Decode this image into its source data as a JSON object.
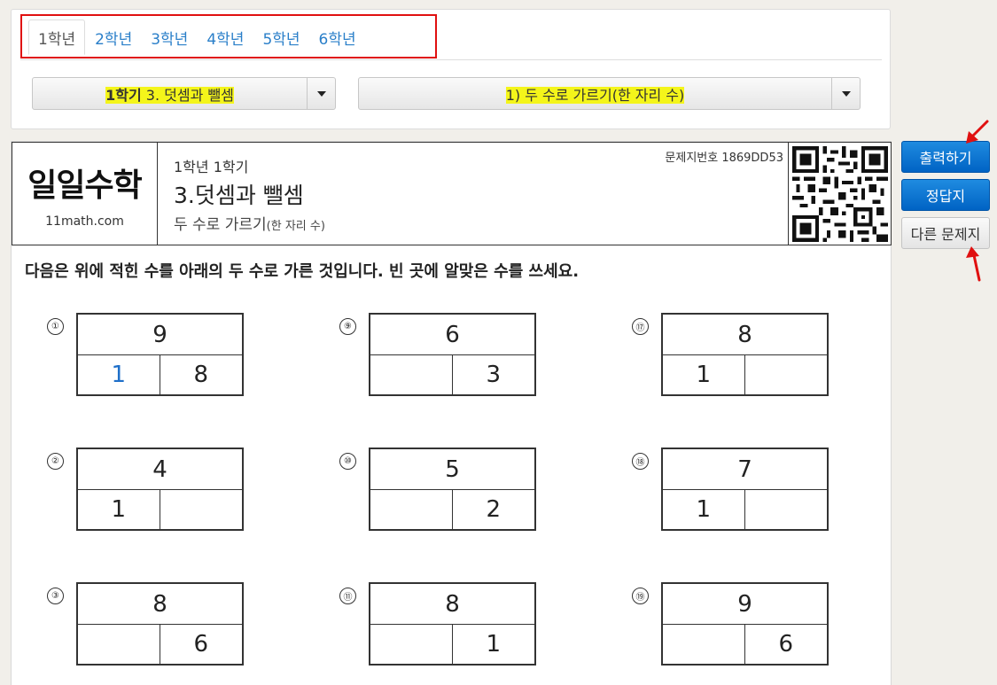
{
  "grade_tabs": [
    "1학년",
    "2학년",
    "3학년",
    "4학년",
    "5학년",
    "6학년"
  ],
  "unit_select": {
    "bold": "1학기",
    "rest": " 3. 덧셈과 뺄셈"
  },
  "topic_select": {
    "label": "1) 두 수로 가르기(한 자리 수)"
  },
  "header": {
    "logo": "일일수학",
    "url": "11math.com",
    "grade_semester": "1학년 1학기",
    "unit_title": "3.덧셈과 뺄셈",
    "subtitle_main": "두 수로 가르기",
    "subtitle_small": "(한 자리 수)",
    "sheet_code": "문제지번호 1869DD53"
  },
  "instruction": "다음은 위에 적힌 수를 아래의 두 수로 가른 것입니다. 빈 곳에 알맞은 수를 쓰세요.",
  "problems": [
    {
      "num": "①",
      "top": "9",
      "left": "1",
      "right": "8",
      "left_blue": true
    },
    {
      "num": "②",
      "top": "4",
      "left": "1",
      "right": ""
    },
    {
      "num": "③",
      "top": "8",
      "left": "",
      "right": "6"
    },
    {
      "num": "⑨",
      "top": "6",
      "left": "",
      "right": "3"
    },
    {
      "num": "⑩",
      "top": "5",
      "left": "",
      "right": "2"
    },
    {
      "num": "⑪",
      "top": "8",
      "left": "",
      "right": "1"
    },
    {
      "num": "⑰",
      "top": "8",
      "left": "1",
      "right": ""
    },
    {
      "num": "⑱",
      "top": "7",
      "left": "1",
      "right": ""
    },
    {
      "num": "⑲",
      "top": "9",
      "left": "",
      "right": "6"
    }
  ],
  "side_buttons": {
    "print": "출력하기",
    "answers": "정답지",
    "other": "다른 문제지"
  },
  "colors": {
    "tab_link": "#2a7fc9",
    "highlight": "#f4f51a",
    "primary_button": "#0a72d4",
    "annotation_red": "#e01010"
  }
}
